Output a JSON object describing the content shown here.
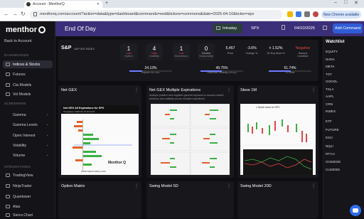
{
  "browser": {
    "tab_title": "Account - MenthorQ",
    "url": "menthorq.com/account/?action=data&type=dashboard&commands=eod&tickers=commons&date=2025-04-10&ticker=spx",
    "new_chrome": "New Chrome available"
  },
  "sidebar": {
    "logo": "menthor",
    "back": "Back to Account",
    "sections": [
      "DASHBOARDS",
      "SCREENERS",
      "INTEGRATIONS"
    ],
    "dashboards": [
      "Indices & Stocks",
      "Futures",
      "Cta Models",
      "Vol Models"
    ],
    "screeners": [
      "Gamma",
      "Gamma Levels",
      "Open Interest",
      "Volatility",
      "Volume"
    ],
    "integrations": [
      "TradingView",
      "NinjaTrader",
      "Quantower",
      "Atas",
      "Sierra Chart"
    ]
  },
  "topbar": {
    "title": "End Of Day",
    "intraday": "Intraday",
    "ticker": "SPX",
    "date": "04/10/2025",
    "add_command": "Add Command"
  },
  "summary": {
    "name": "S&P",
    "full": "S&P 500 INDEX",
    "gauges": [
      {
        "n": "1",
        "l": "Low",
        "k": "Option",
        "color": "#e24545"
      },
      {
        "n": "4",
        "l": "High",
        "k": "Volatility",
        "color": "#e24545"
      },
      {
        "n": "1",
        "l": "Low",
        "k": "Momentum",
        "color": "#e24545"
      },
      {
        "n": "0",
        "l": "Neutral",
        "k": "Seasonality",
        "color": "#bbbbbb"
      }
    ],
    "metrics": [
      {
        "v": "5,457",
        "k": "Price"
      },
      {
        "v": "-3.6%",
        "k": "Change %"
      },
      {
        "v": "± 1.52%",
        "k": "1D Exp Move %"
      },
      {
        "v": "Negative",
        "k": "Gamma Condition"
      }
    ],
    "stats": [
      {
        "v": "24.13%",
        "k": "Implied Vol 30D"
      },
      {
        "v": "49.75%",
        "k": "Historical Volatility (HV30)"
      },
      {
        "v": "51.74%",
        "k": "IV Rank"
      }
    ]
  },
  "watchlist": {
    "title": "Watchlist",
    "items": [
      "EQUITY",
      "NVDA",
      "META",
      "TGT",
      "GOOGL",
      "TSLA",
      "AAPL",
      "CRN",
      "INDEX",
      "ETF",
      "FUTURE",
      "ES1!",
      "NQ1!",
      "RTY1!",
      "GCM2025",
      "CLM2025"
    ]
  },
  "cards": [
    {
      "title": "Net GEX",
      "sub": "",
      "img_title": "Net GEX All Expirations for SPX",
      "img_sub": "Timestamp: 2025-04-10 16:14:22"
    },
    {
      "title": "Net GEX Multiple Expirations",
      "sub": "Analyze positive and negative gamma exposure to assess market behavior and volatility across multiple expirations."
    },
    {
      "title": "Skew 1M",
      "sub": "",
      "img_title": "1 Month skew for SPX"
    },
    {
      "title": "Option Matrix"
    },
    {
      "title": "Swing Model 5D"
    },
    {
      "title": "Swing Model 20D"
    }
  ],
  "watermark": "Menthor Q",
  "website": "WWW.MENTHORQ.COM",
  "colors": {
    "accent": "#3b2f79",
    "green": "#3cb043",
    "orange": "#e2612a",
    "red": "#e24545"
  }
}
